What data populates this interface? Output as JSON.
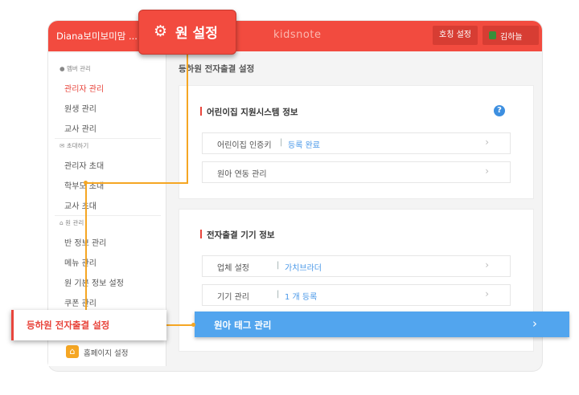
{
  "topbar": {
    "account": "Diana보미보미맘 ...",
    "logo": "kidsnote",
    "settings_label": "호칭 설정",
    "user_name": "김하늘"
  },
  "callout": {
    "icon": "gear-icon",
    "title": "원 설정"
  },
  "sidebar": {
    "member_head": "멤버 관리",
    "member_items": [
      "관리자 관리",
      "원생 관리",
      "교사 관리"
    ],
    "invite_head": "초대하기",
    "invite_items": [
      "관리자 초대",
      "학부모 초대",
      "교사 초대"
    ],
    "kinder_head": "원 관리",
    "kinder_items": [
      "반 정보 관리",
      "메뉴 관리",
      "원 기본 정보 설정",
      "쿠폰 관리"
    ],
    "homepage": "홈페이지 설정"
  },
  "breadcrumb": "등하원 전자출결 설정",
  "card1": {
    "title": "어린이집 지원시스템 정보",
    "rows": [
      {
        "label": "어린이집 인증키",
        "sep": "|",
        "value": "등록 완료"
      },
      {
        "label": "원아 연동 관리",
        "sep": "",
        "value": ""
      }
    ]
  },
  "card2": {
    "title": "전자출결 기기 정보",
    "rows": [
      {
        "label": "업체 설정",
        "sep": "|",
        "value": "가치브라더"
      },
      {
        "label": "기기 관리",
        "sep": "|",
        "value": "1 개 등록"
      }
    ],
    "highlight_row": "원아 태그 관리"
  },
  "left_callout": "등하원 전자출결 설정",
  "colors": {
    "brand_red": "#f24b3f",
    "accent_blue": "#52a5ee",
    "connector_orange": "#f5a623"
  }
}
